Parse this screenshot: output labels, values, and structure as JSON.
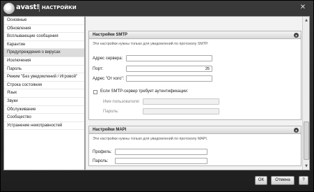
{
  "window": {
    "brand": "avast!",
    "title": "НАСТРОЙКИ",
    "close_glyph": "✕"
  },
  "sidebar": {
    "items": [
      {
        "label": "Основные"
      },
      {
        "label": "Обновления"
      },
      {
        "label": "Всплывающие сообщения"
      },
      {
        "label": "Карантин"
      },
      {
        "label": "Предупреждения о вирусах"
      },
      {
        "label": "Исключения"
      },
      {
        "label": "Пароль"
      },
      {
        "label": "Режим \"Без уведомлений / Игровой\""
      },
      {
        "label": "Строка состояния"
      },
      {
        "label": "Язык"
      },
      {
        "label": "Звуки"
      },
      {
        "label": "Обслуживание"
      },
      {
        "label": "Сообщество"
      },
      {
        "label": "Устранение неисправностей"
      }
    ],
    "active_index": 4
  },
  "smtp": {
    "header": "Настройки SMTP",
    "description": "Эти настройки нужны только для уведомлений по протоколу SMTP.",
    "server_label": "Адрес сервера:",
    "server_value": "",
    "port_label": "Порт:",
    "port_value": "25",
    "from_label": "Адрес \"От кого\":",
    "from_value": "",
    "auth_label": "Если SMTP-сервер требует аутентификации:",
    "auth_checked": false,
    "username_label": "Имя пользователя:",
    "password_label": "Пароль:"
  },
  "mapi": {
    "header": "Настройки MAPI",
    "description": "Эти настройки нужны только для уведомлений по протоколу MAPI.",
    "profile_label": "Профиль:",
    "password_label": "Пароль:"
  },
  "buttons": {
    "ok": "ОК",
    "cancel": "Отмена",
    "help": "?"
  },
  "icons": {
    "collapse": "chevron-up-icon",
    "scroll_up": "▲",
    "scroll_down": "▼"
  }
}
